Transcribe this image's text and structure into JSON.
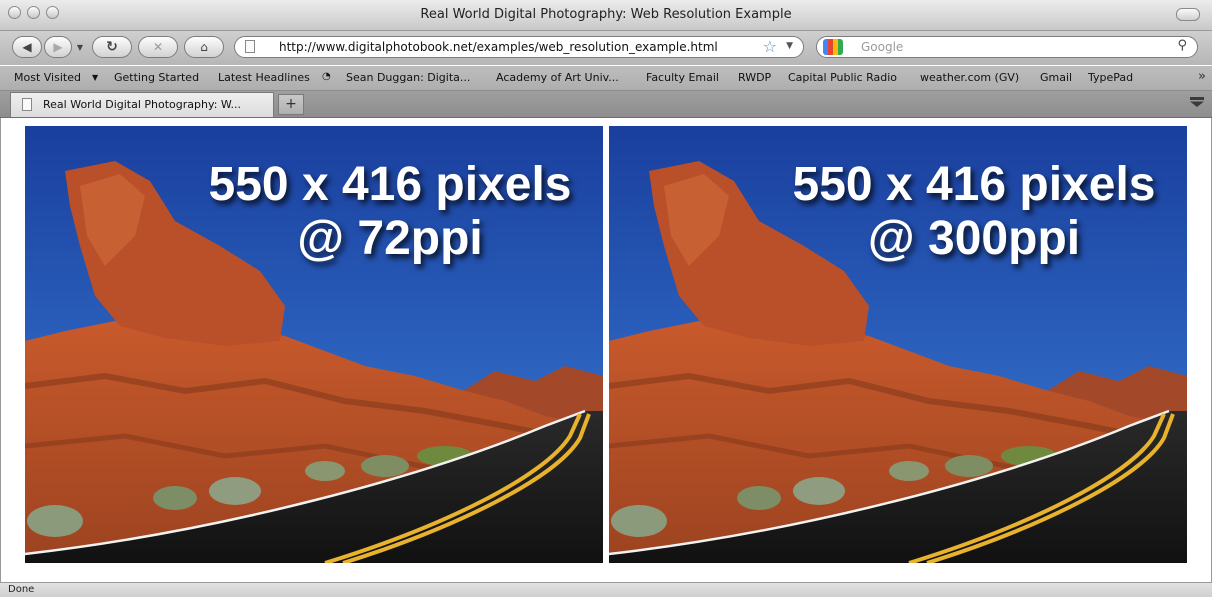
{
  "window": {
    "title": "Real World Digital Photography: Web Resolution Example"
  },
  "nav": {
    "url": "http://www.digitalphotobook.net/examples/web_resolution_example.html"
  },
  "search": {
    "placeholder": "Google"
  },
  "bookmarks": [
    "Most Visited",
    "Getting Started",
    "Latest Headlines",
    "Sean Duggan: Digita...",
    "Academy of Art Univ...",
    "Faculty Email",
    "RWDP",
    "Capital Public Radio",
    "weather.com (GV)",
    "Gmail",
    "TypePad"
  ],
  "tab": {
    "title": "Real World Digital Photography: W..."
  },
  "images": [
    {
      "line1": "550 x 416 pixels",
      "line2": "@ 72ppi"
    },
    {
      "line1": "550 x 416 pixels",
      "line2": "@ 300ppi"
    }
  ],
  "status": {
    "text": "Done"
  }
}
